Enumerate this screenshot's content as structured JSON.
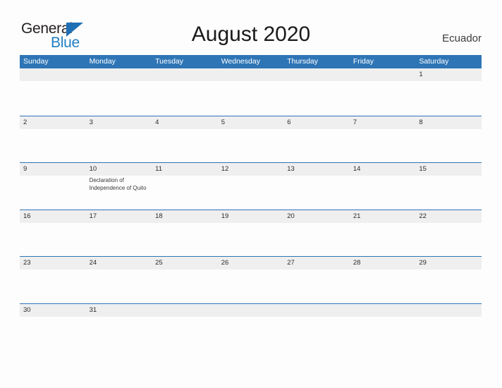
{
  "brand": {
    "name_part1": "General",
    "name_part2": "Blue",
    "triangle_icon": "blue-triangle-icon",
    "color_dark": "#231f20",
    "color_blue": "#1f7fc4"
  },
  "header": {
    "title": "August 2020",
    "region": "Ecuador"
  },
  "calendar": {
    "accent_color": "#2e75b6",
    "band_color": "#efefef",
    "weekdays": [
      "Sunday",
      "Monday",
      "Tuesday",
      "Wednesday",
      "Thursday",
      "Friday",
      "Saturday"
    ],
    "weeks": [
      [
        {
          "day": ""
        },
        {
          "day": ""
        },
        {
          "day": ""
        },
        {
          "day": ""
        },
        {
          "day": ""
        },
        {
          "day": ""
        },
        {
          "day": "1"
        }
      ],
      [
        {
          "day": "2"
        },
        {
          "day": "3"
        },
        {
          "day": "4"
        },
        {
          "day": "5"
        },
        {
          "day": "6"
        },
        {
          "day": "7"
        },
        {
          "day": "8"
        }
      ],
      [
        {
          "day": "9"
        },
        {
          "day": "10",
          "event": "Declaration of Independence of Quito"
        },
        {
          "day": "11"
        },
        {
          "day": "12"
        },
        {
          "day": "13"
        },
        {
          "day": "14"
        },
        {
          "day": "15"
        }
      ],
      [
        {
          "day": "16"
        },
        {
          "day": "17"
        },
        {
          "day": "18"
        },
        {
          "day": "19"
        },
        {
          "day": "20"
        },
        {
          "day": "21"
        },
        {
          "day": "22"
        }
      ],
      [
        {
          "day": "23"
        },
        {
          "day": "24"
        },
        {
          "day": "25"
        },
        {
          "day": "26"
        },
        {
          "day": "27"
        },
        {
          "day": "28"
        },
        {
          "day": "29"
        }
      ],
      [
        {
          "day": "30"
        },
        {
          "day": "31"
        },
        {
          "day": ""
        },
        {
          "day": ""
        },
        {
          "day": ""
        },
        {
          "day": ""
        },
        {
          "day": ""
        }
      ]
    ]
  }
}
